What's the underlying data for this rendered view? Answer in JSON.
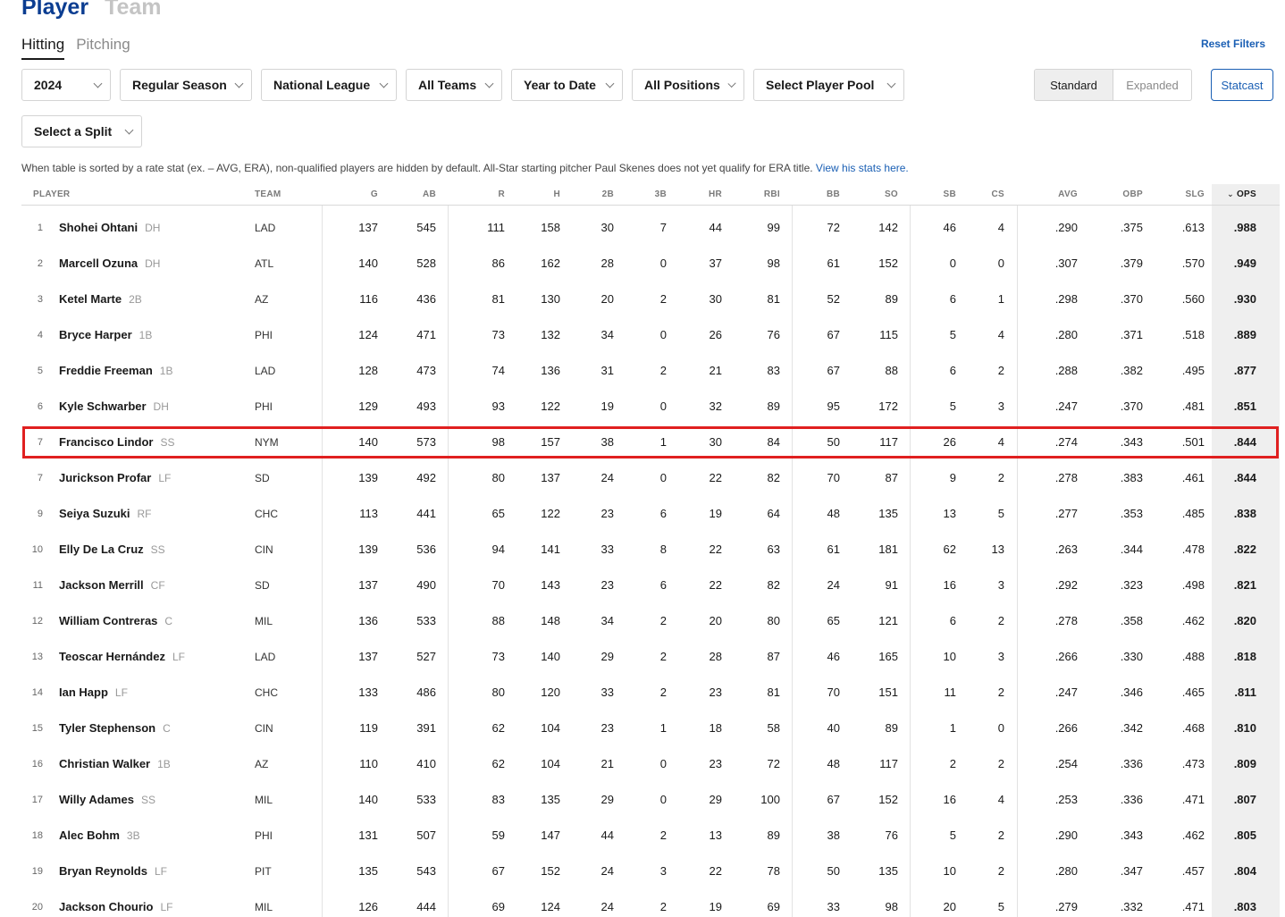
{
  "top_tabs": [
    "Player",
    "Team"
  ],
  "sub_tabs": [
    "Hitting",
    "Pitching"
  ],
  "reset_filters": "Reset Filters",
  "filters": {
    "season": "2024",
    "game_type": "Regular Season",
    "league": "National League",
    "teams": "All Teams",
    "period": "Year to Date",
    "positions": "All Positions",
    "player_pool": "Select Player Pool",
    "split": "Select a Split"
  },
  "view_toggle": [
    "Standard",
    "Expanded"
  ],
  "statcast": "Statcast",
  "note": {
    "text": "When table is sorted by a rate stat (ex. – AVG, ERA), non-qualified players are hidden by default. All-Star starting pitcher Paul Skenes does not yet qualify for ERA title. ",
    "link": "View his stats here."
  },
  "columns": [
    "PLAYER",
    "TEAM",
    "G",
    "AB",
    "R",
    "H",
    "2B",
    "3B",
    "HR",
    "RBI",
    "BB",
    "SO",
    "SB",
    "CS",
    "AVG",
    "OBP",
    "SLG",
    "OPS"
  ],
  "sort_column": "OPS",
  "highlight_color": "#e02020",
  "rows": [
    {
      "rank": "1",
      "name": "Shohei Ohtani",
      "pos": "DH",
      "team": "LAD",
      "stats": [
        "137",
        "545",
        "111",
        "158",
        "30",
        "7",
        "44",
        "99",
        "72",
        "142",
        "46",
        "4",
        ".290",
        ".375",
        ".613",
        ".988"
      ]
    },
    {
      "rank": "2",
      "name": "Marcell Ozuna",
      "pos": "DH",
      "team": "ATL",
      "stats": [
        "140",
        "528",
        "86",
        "162",
        "28",
        "0",
        "37",
        "98",
        "61",
        "152",
        "0",
        "0",
        ".307",
        ".379",
        ".570",
        ".949"
      ]
    },
    {
      "rank": "3",
      "name": "Ketel Marte",
      "pos": "2B",
      "team": "AZ",
      "stats": [
        "116",
        "436",
        "81",
        "130",
        "20",
        "2",
        "30",
        "81",
        "52",
        "89",
        "6",
        "1",
        ".298",
        ".370",
        ".560",
        ".930"
      ]
    },
    {
      "rank": "4",
      "name": "Bryce Harper",
      "pos": "1B",
      "team": "PHI",
      "stats": [
        "124",
        "471",
        "73",
        "132",
        "34",
        "0",
        "26",
        "76",
        "67",
        "115",
        "5",
        "4",
        ".280",
        ".371",
        ".518",
        ".889"
      ]
    },
    {
      "rank": "5",
      "name": "Freddie Freeman",
      "pos": "1B",
      "team": "LAD",
      "stats": [
        "128",
        "473",
        "74",
        "136",
        "31",
        "2",
        "21",
        "83",
        "67",
        "88",
        "6",
        "2",
        ".288",
        ".382",
        ".495",
        ".877"
      ]
    },
    {
      "rank": "6",
      "name": "Kyle Schwarber",
      "pos": "DH",
      "team": "PHI",
      "stats": [
        "129",
        "493",
        "93",
        "122",
        "19",
        "0",
        "32",
        "89",
        "95",
        "172",
        "5",
        "3",
        ".247",
        ".370",
        ".481",
        ".851"
      ]
    },
    {
      "rank": "7",
      "name": "Francisco Lindor",
      "pos": "SS",
      "team": "NYM",
      "stats": [
        "140",
        "573",
        "98",
        "157",
        "38",
        "1",
        "30",
        "84",
        "50",
        "117",
        "26",
        "4",
        ".274",
        ".343",
        ".501",
        ".844"
      ]
    },
    {
      "rank": "7",
      "name": "Jurickson Profar",
      "pos": "LF",
      "team": "SD",
      "stats": [
        "139",
        "492",
        "80",
        "137",
        "24",
        "0",
        "22",
        "82",
        "70",
        "87",
        "9",
        "2",
        ".278",
        ".383",
        ".461",
        ".844"
      ]
    },
    {
      "rank": "9",
      "name": "Seiya Suzuki",
      "pos": "RF",
      "team": "CHC",
      "stats": [
        "113",
        "441",
        "65",
        "122",
        "23",
        "6",
        "19",
        "64",
        "48",
        "135",
        "13",
        "5",
        ".277",
        ".353",
        ".485",
        ".838"
      ]
    },
    {
      "rank": "10",
      "name": "Elly De La Cruz",
      "pos": "SS",
      "team": "CIN",
      "stats": [
        "139",
        "536",
        "94",
        "141",
        "33",
        "8",
        "22",
        "63",
        "61",
        "181",
        "62",
        "13",
        ".263",
        ".344",
        ".478",
        ".822"
      ]
    },
    {
      "rank": "11",
      "name": "Jackson Merrill",
      "pos": "CF",
      "team": "SD",
      "stats": [
        "137",
        "490",
        "70",
        "143",
        "23",
        "6",
        "22",
        "82",
        "24",
        "91",
        "16",
        "3",
        ".292",
        ".323",
        ".498",
        ".821"
      ]
    },
    {
      "rank": "12",
      "name": "William Contreras",
      "pos": "C",
      "team": "MIL",
      "stats": [
        "136",
        "533",
        "88",
        "148",
        "34",
        "2",
        "20",
        "80",
        "65",
        "121",
        "6",
        "2",
        ".278",
        ".358",
        ".462",
        ".820"
      ]
    },
    {
      "rank": "13",
      "name": "Teoscar Hernández",
      "pos": "LF",
      "team": "LAD",
      "stats": [
        "137",
        "527",
        "73",
        "140",
        "29",
        "2",
        "28",
        "87",
        "46",
        "165",
        "10",
        "3",
        ".266",
        ".330",
        ".488",
        ".818"
      ]
    },
    {
      "rank": "14",
      "name": "Ian Happ",
      "pos": "LF",
      "team": "CHC",
      "stats": [
        "133",
        "486",
        "80",
        "120",
        "33",
        "2",
        "23",
        "81",
        "70",
        "151",
        "11",
        "2",
        ".247",
        ".346",
        ".465",
        ".811"
      ]
    },
    {
      "rank": "15",
      "name": "Tyler Stephenson",
      "pos": "C",
      "team": "CIN",
      "stats": [
        "119",
        "391",
        "62",
        "104",
        "23",
        "1",
        "18",
        "58",
        "40",
        "89",
        "1",
        "0",
        ".266",
        ".342",
        ".468",
        ".810"
      ]
    },
    {
      "rank": "16",
      "name": "Christian Walker",
      "pos": "1B",
      "team": "AZ",
      "stats": [
        "110",
        "410",
        "62",
        "104",
        "21",
        "0",
        "23",
        "72",
        "48",
        "117",
        "2",
        "2",
        ".254",
        ".336",
        ".473",
        ".809"
      ]
    },
    {
      "rank": "17",
      "name": "Willy Adames",
      "pos": "SS",
      "team": "MIL",
      "stats": [
        "140",
        "533",
        "83",
        "135",
        "29",
        "0",
        "29",
        "100",
        "67",
        "152",
        "16",
        "4",
        ".253",
        ".336",
        ".471",
        ".807"
      ]
    },
    {
      "rank": "18",
      "name": "Alec Bohm",
      "pos": "3B",
      "team": "PHI",
      "stats": [
        "131",
        "507",
        "59",
        "147",
        "44",
        "2",
        "13",
        "89",
        "38",
        "76",
        "5",
        "2",
        ".290",
        ".343",
        ".462",
        ".805"
      ]
    },
    {
      "rank": "19",
      "name": "Bryan Reynolds",
      "pos": "LF",
      "team": "PIT",
      "stats": [
        "135",
        "543",
        "67",
        "152",
        "24",
        "3",
        "22",
        "78",
        "50",
        "135",
        "10",
        "2",
        ".280",
        ".347",
        ".457",
        ".804"
      ]
    },
    {
      "rank": "20",
      "name": "Jackson Chourio",
      "pos": "LF",
      "team": "MIL",
      "stats": [
        "126",
        "444",
        "69",
        "124",
        "24",
        "2",
        "19",
        "69",
        "33",
        "98",
        "20",
        "5",
        ".279",
        ".332",
        ".471",
        ".803"
      ]
    }
  ]
}
